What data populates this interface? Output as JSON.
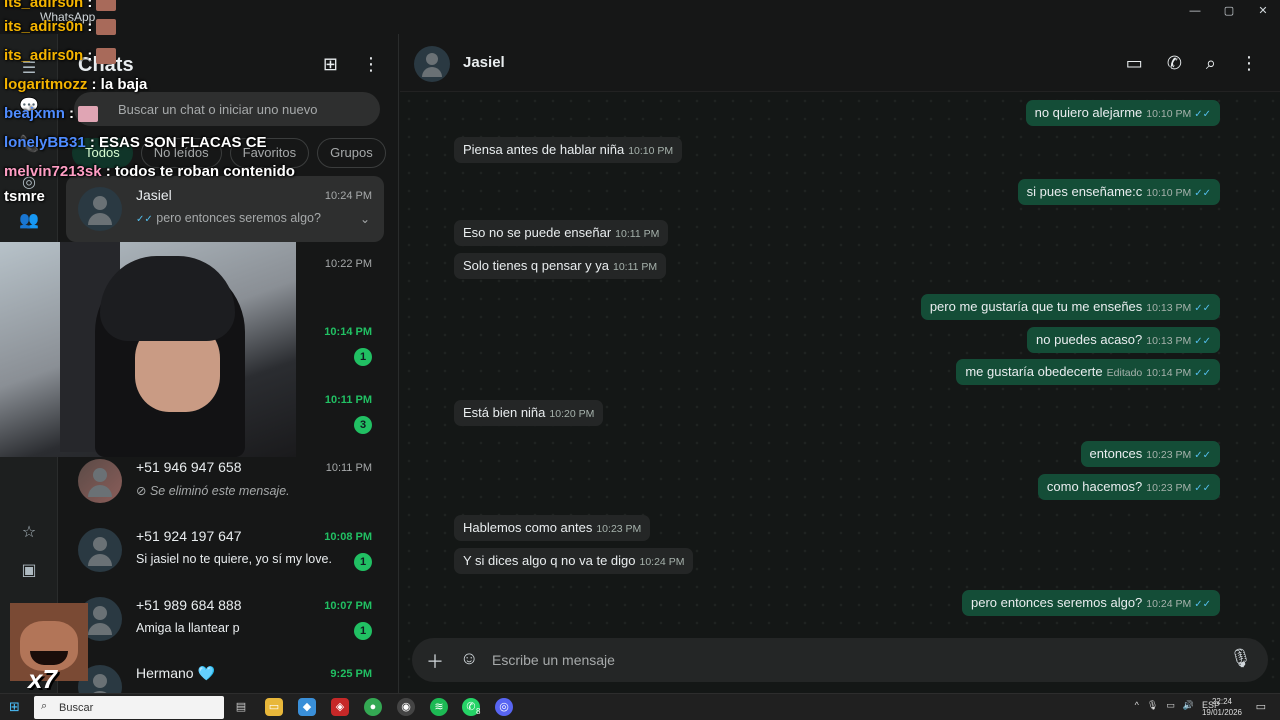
{
  "window": {
    "app_name": "WhatsApp",
    "controls": [
      "—",
      "▢",
      "✕"
    ]
  },
  "sidebar": {
    "title": "Chats",
    "search_placeholder": "Buscar un chat o iniciar uno nuevo",
    "filters": [
      "Todos",
      "No leídos",
      "Favoritos",
      "Grupos"
    ],
    "chats": [
      {
        "name": "Jasiel",
        "time": "10:24 PM",
        "preview": "pero entonces seremos algo?",
        "unread": "",
        "selected": true
      },
      {
        "name": "",
        "time": "10:22 PM",
        "preview": "",
        "unread": ""
      },
      {
        "name": "",
        "time": "10:14 PM",
        "preview": "",
        "unread": "1"
      },
      {
        "name": "",
        "time": "10:11 PM",
        "preview": "",
        "unread": "3"
      },
      {
        "name": "+51 946 947 658",
        "time": "10:11 PM",
        "preview": "Se eliminó este mensaje.",
        "unread": ""
      },
      {
        "name": "+51 924 197 647",
        "time": "10:08 PM",
        "preview": "Si jasiel no te quiere, yo sí my love.",
        "unread": "1"
      },
      {
        "name": "+51 989 684 888",
        "time": "10:07 PM",
        "preview": "Amiga la llantear p",
        "unread": "1"
      },
      {
        "name": "Hermano 🩵",
        "time": "9:25 PM",
        "preview": "",
        "unread": ""
      }
    ]
  },
  "conversation": {
    "contact_name": "Jasiel",
    "messages": [
      {
        "dir": "out",
        "text": "no quiero alejarme",
        "time": "10:10 PM"
      },
      {
        "dir": "in",
        "text": "Piensa antes de hablar niña",
        "time": "10:10 PM"
      },
      {
        "dir": "out",
        "text": "si pues enseñame:c",
        "time": "10:10 PM"
      },
      {
        "dir": "in",
        "text": "Eso no se puede enseñar",
        "time": "10:11 PM"
      },
      {
        "dir": "in",
        "text": "Solo tienes q pensar y ya",
        "time": "10:11 PM"
      },
      {
        "dir": "out",
        "text": "pero me gustaría que tu me enseñes",
        "time": "10:13 PM"
      },
      {
        "dir": "out",
        "text": "no puedes acaso?",
        "time": "10:13 PM"
      },
      {
        "dir": "out",
        "text": "me gustaría obedecerte",
        "time": "10:14 PM",
        "edited": "Editado"
      },
      {
        "dir": "in",
        "text": "Está bien niña",
        "time": "10:20 PM"
      },
      {
        "dir": "out",
        "text": "entonces",
        "time": "10:23 PM"
      },
      {
        "dir": "out",
        "text": "como hacemos?",
        "time": "10:23 PM"
      },
      {
        "dir": "in",
        "text": "Hablemos como antes",
        "time": "10:23 PM"
      },
      {
        "dir": "in",
        "text": "Y si dices algo q no va te digo",
        "time": "10:24 PM"
      },
      {
        "dir": "out",
        "text": "pero entonces seremos algo?",
        "time": "10:24 PM"
      }
    ],
    "composer_placeholder": "Escribe un mensaje"
  },
  "stream_overlay": {
    "chat_lines": [
      {
        "user": "its_adirs0n",
        "text": ":"
      },
      {
        "user": "its_adirs0n",
        "text": ":"
      },
      {
        "user": "its_adirs0n",
        "text": ":"
      },
      {
        "user": "logaritmozz",
        "text": ": la baja"
      },
      {
        "user": "beajxmn",
        "text": ":"
      },
      {
        "user": "lonelyBB31",
        "text": ": ESAS SON FLACAS CE"
      },
      {
        "user": "melvin7213sk",
        "text": ": todos te roban contenido"
      },
      {
        "user": "tsmre",
        "text": ""
      }
    ],
    "meme_label": "x7"
  },
  "taskbar": {
    "search_label": "Buscar",
    "tray_lang": "ESP",
    "clock_time": "22:24",
    "clock_date": "19/01/2026",
    "whatsapp_badge": "8"
  },
  "colors": {
    "accent_green": "#21c063",
    "bubble_out": "#144d37",
    "bubble_in": "#242626",
    "read_tick": "#53bdeb"
  }
}
